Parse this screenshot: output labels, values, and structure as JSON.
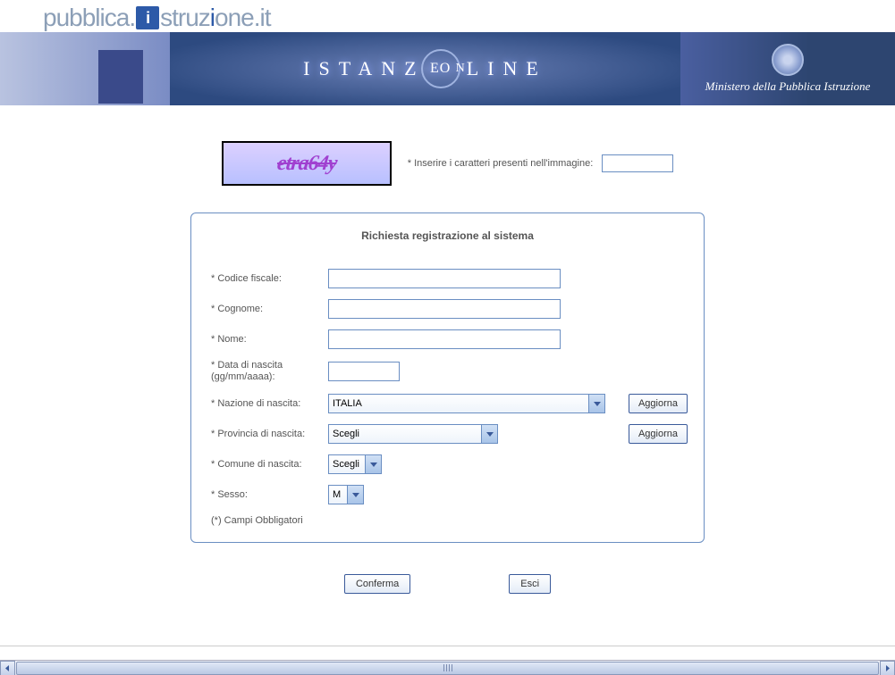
{
  "logo": {
    "part1": "pubblica",
    "dot": ".",
    "icon_letter": "i",
    "part2": "struz",
    "part2_accent": "i",
    "part3": "one",
    "tld": ".it"
  },
  "banner": {
    "title_pre": "ISTANZ",
    "title_circle": "EO",
    "title_suffix_n": "N",
    "title_post": "LINE",
    "ministry": "Ministero della Pubblica Istruzione"
  },
  "captcha": {
    "image_text": "etra64y",
    "label": "* Inserire i caratteri presenti nell'immagine:",
    "value": ""
  },
  "form": {
    "title": "Richiesta registrazione al sistema",
    "codice_fiscale": {
      "label": "* Codice fiscale:",
      "value": ""
    },
    "cognome": {
      "label": "* Cognome:",
      "value": ""
    },
    "nome": {
      "label": "* Nome:",
      "value": ""
    },
    "data_nascita": {
      "label": "* Data di nascita (gg/mm/aaaa):",
      "value": ""
    },
    "nazione": {
      "label": "* Nazione di nascita:",
      "selected": "ITALIA",
      "update": "Aggiorna"
    },
    "provincia": {
      "label": "* Provincia di nascita:",
      "selected": "Scegli",
      "update": "Aggiorna"
    },
    "comune": {
      "label": "* Comune di nascita:",
      "selected": "Scegli"
    },
    "sesso": {
      "label": "* Sesso:",
      "selected": "M"
    },
    "note": "(*) Campi Obbligatori"
  },
  "buttons": {
    "conferma": "Conferma",
    "esci": "Esci"
  }
}
